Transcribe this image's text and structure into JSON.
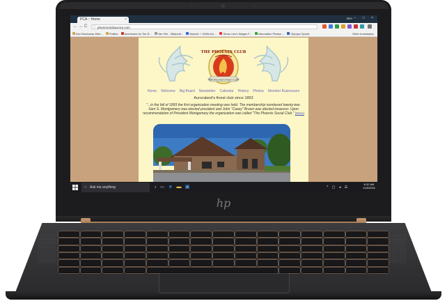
{
  "browser": {
    "tab_title": "PCA :: Home",
    "tab_close": "×",
    "url": "phoenixclubaurora.com",
    "profile": "Ben",
    "window_controls": "–  □  ×",
    "nav": {
      "back": "←",
      "forward": "→",
      "reload": "C"
    }
  },
  "bookmarks": [
    {
      "label": "Dev Bootcamp Web..."
    },
    {
      "label": "Politics"
    },
    {
      "label": "Americans for Tax R..."
    },
    {
      "label": "Van File - Wikipedi..."
    },
    {
      "label": "March4 + 1990s Art ..."
    },
    {
      "label": "Show Live's Wages F..."
    },
    {
      "label": "Information Please ..."
    },
    {
      "label": "Olympic Sports"
    }
  ],
  "bookmarks_other": "Other bookmarks",
  "site": {
    "crest_text": "THE PHOENIX CLUB",
    "crest_subtext": "AURORALAND'S FINEST CLUB",
    "menu": [
      "Home",
      "Welcome",
      "Big Board",
      "Newsletter",
      "Calendar",
      "History",
      "Photos",
      "Member Businesses"
    ],
    "tagline": "Auroraland's finest club since 1893",
    "quote": "\"...in the fall of 1893 the first organization meeting was held. The membership numbered twenty-two. Sam S. Montgomery was elected president and John \"Casey\" Brown was elected treasurer. Upon recommendation of President Montgomery the organization was called \"The Phoenix Social Club.\"",
    "more_link": "(More)"
  },
  "taskbar": {
    "search_placeholder": "Ask me anything",
    "search_icon": "magnifier-icon",
    "tray_icons": "^ ▢ ◂ ☰",
    "time": "6:32 AM",
    "date": "11/8/2016"
  },
  "laptop": {
    "brand": "hp"
  },
  "colors": {
    "page_bg": "#c8a27d",
    "content_bg": "#fdf6c6",
    "link": "#6a6ac0",
    "taskbar": "#1b1b1f",
    "bronze": "#b58a64"
  }
}
